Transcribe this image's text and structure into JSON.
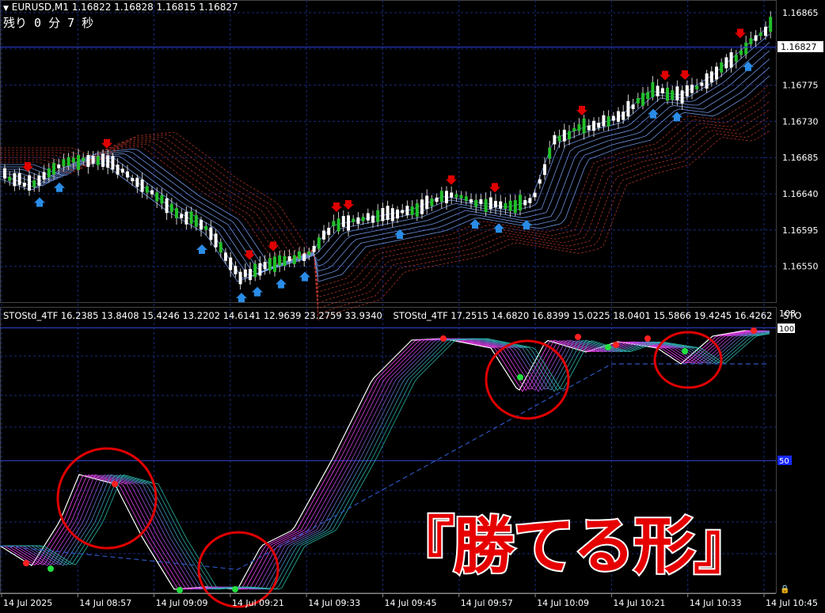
{
  "window": {
    "symbol_title": "EURUSD,M1  1.16822 1.16828 1.16815 1.16827",
    "countdown": "残り 0 分 7 秒"
  },
  "price_axis": {
    "labels": [
      "1.16865",
      "1.16820",
      "1.16775",
      "1.16730",
      "1.16685",
      "1.16640",
      "1.16595",
      "1.16550"
    ],
    "current_price": "1.16827"
  },
  "indicator": {
    "label_1": "STOStd_4TF 16.2385 13.8408 15.4246 13.2202 14.6141 12.9639 23.2759 33.9340",
    "label_2": "STOStd_4TF 17.2515 14.6820 16.8399 15.0225 18.0401 15.5866 19.4245 16.4262",
    "label_3": "STO",
    "axis_top": "108",
    "level_100": "100",
    "level_50": "50"
  },
  "time_axis": {
    "labels": [
      "14 Jul 2025",
      "14 Jul 08:57",
      "14 Jul 09:09",
      "14 Jul 09:21",
      "14 Jul 09:33",
      "14 Jul 09:45",
      "14 Jul 09:57",
      "14 Jul 10:09",
      "14 Jul 10:21",
      "14 Jul 10:33",
      "14 Jul 10:45"
    ]
  },
  "caption": "『勝てる形』",
  "colors": {
    "background": "#000000",
    "grid": "#1a2a7a",
    "bull_candle": "#22c02a",
    "bear_candle": "#ffffff",
    "sell_arrow": "#e00000",
    "buy_arrow": "#2a8ce6",
    "circle": "#e00000"
  }
}
